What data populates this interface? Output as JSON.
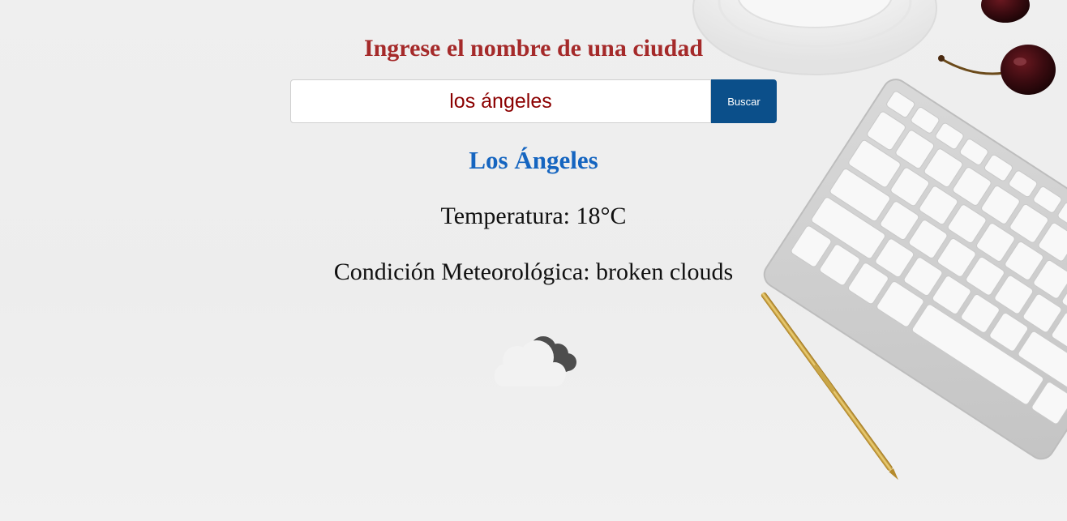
{
  "header": {
    "title": "Ingrese el nombre de una ciudad"
  },
  "search": {
    "value": "los ángeles",
    "button_label": "Buscar"
  },
  "weather": {
    "city": "Los Ángeles",
    "temperature": "Temperatura: 18°C",
    "condition": "Condición Meteorológica: broken clouds",
    "icon": "broken-clouds-icon"
  },
  "colors": {
    "title": "#a52a2a",
    "input_text": "#8b0000",
    "button_bg": "#0b4f8a",
    "city": "#1565c0"
  }
}
